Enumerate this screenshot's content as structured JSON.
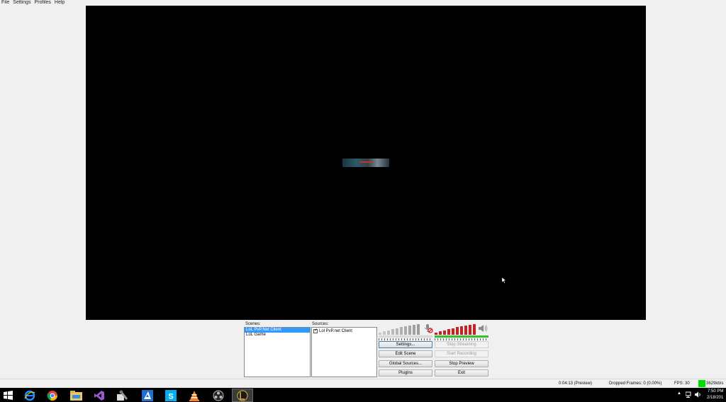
{
  "menu": [
    "File",
    "Settings",
    "Profiles",
    "Help"
  ],
  "scenes": {
    "label": "Scenes:",
    "items": [
      {
        "name": "LoL PvP.Net Client",
        "selected": true
      },
      {
        "name": "LoL Game",
        "selected": false
      }
    ]
  },
  "sources": {
    "label": "Sources:",
    "items": [
      {
        "name": "Lol PvP.net Client",
        "checked": true
      }
    ]
  },
  "buttons": {
    "settings": "Settings...",
    "stop_streaming": "Stop Streaming",
    "edit_scene": "Edit Scene",
    "start_recording": "Start Recording",
    "global_sources": "Global Sources...",
    "stop_preview": "Stop Preview",
    "plugins": "Plugins",
    "exit": "Exit"
  },
  "status": {
    "time": "0:04:13 (Preview)",
    "dropped_frames": "Dropped Frames: 0 (0.00%)",
    "fps": "FPS: 30",
    "bitrate": "3629kb/s",
    "bitrate_color": "#00e000"
  },
  "taskbar": {
    "apps": [
      "windows-start",
      "internet-explorer",
      "chrome",
      "file-explorer",
      "visual-studio",
      "tools",
      "azure",
      "skype",
      "vlc",
      "obs",
      "league-of-legends"
    ],
    "clock_time": "7:50 PM",
    "clock_date": "2/18/201"
  },
  "colors": {
    "selection": "#3399ff",
    "volume_active": "#cc1f1f",
    "meter_green": "#2fbf2f"
  }
}
